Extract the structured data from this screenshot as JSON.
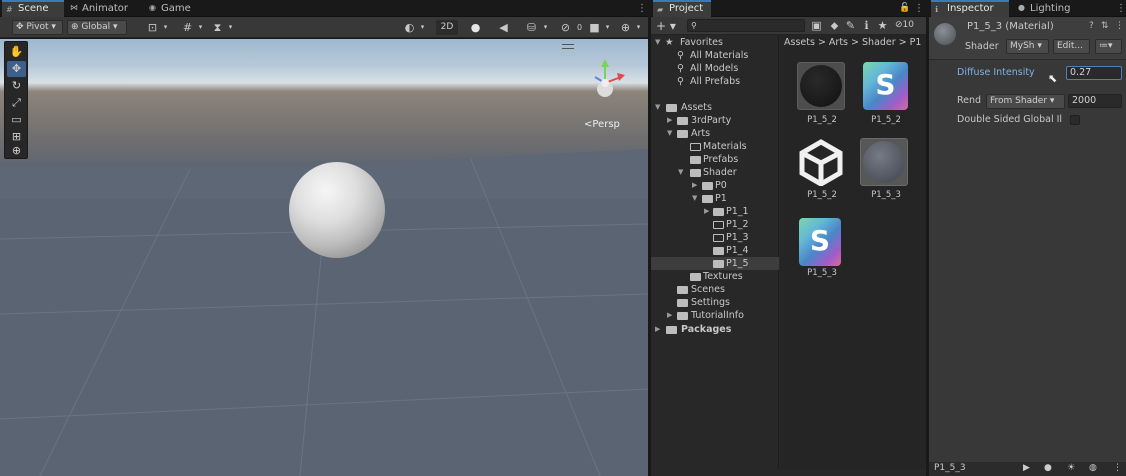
{
  "scene_tabs": [
    {
      "label": "Scene",
      "icon": "grid-icon"
    },
    {
      "label": "Animator",
      "icon": "animator-icon"
    },
    {
      "label": "Game",
      "icon": "gamepad-icon"
    }
  ],
  "scene_toolbar": {
    "pivot": "Pivot",
    "global": "Global",
    "mode_2d": "2D"
  },
  "scene_view": {
    "projection": "<Persp"
  },
  "project": {
    "tab_label": "Project",
    "add_label": "+",
    "hidden_count": "10",
    "breadcrumb": [
      "Assets",
      "Arts",
      "Shader",
      "P1"
    ],
    "favorites": {
      "label": "Favorites",
      "items": [
        "All Materials",
        "All Models",
        "All Prefabs"
      ]
    },
    "tree": [
      {
        "label": "Assets"
      },
      {
        "label": "3rdParty"
      },
      {
        "label": "Arts"
      },
      {
        "label": "Materials"
      },
      {
        "label": "Prefabs"
      },
      {
        "label": "Shader"
      },
      {
        "label": "P0"
      },
      {
        "label": "P1"
      },
      {
        "label": "P1_1"
      },
      {
        "label": "P1_2"
      },
      {
        "label": "P1_3"
      },
      {
        "label": "P1_4"
      },
      {
        "label": "P1_5"
      },
      {
        "label": "Textures"
      },
      {
        "label": "Scenes"
      },
      {
        "label": "Settings"
      },
      {
        "label": "TutorialInfo"
      },
      {
        "label": "Packages"
      }
    ],
    "assets": [
      {
        "name": "P1_5_2",
        "kind": "material-black"
      },
      {
        "name": "P1_5_2",
        "kind": "shader"
      },
      {
        "name": "P1_5_2",
        "kind": "unity-logo"
      },
      {
        "name": "P1_5_3",
        "kind": "material-gray"
      },
      {
        "name": "P1_5_3",
        "kind": "shader"
      }
    ]
  },
  "inspector": {
    "tab_label": "Inspector",
    "lighting_tab": "Lighting",
    "material_title": "P1_5_3 (Material)",
    "shader_label": "Shader",
    "shader_value": "MySh",
    "edit_label": "Edit...",
    "properties": [
      {
        "label": "Diffuse Intensity",
        "value": "0.27"
      },
      {
        "label": "Rend",
        "dropdown": "From Shader",
        "value": "2000"
      },
      {
        "label": "Double Sided Global Il"
      }
    ],
    "footer_name": "P1_5_3"
  },
  "colors": {
    "accent": "#3a79bb",
    "panel": "#383838",
    "dark_panel": "#282828"
  }
}
